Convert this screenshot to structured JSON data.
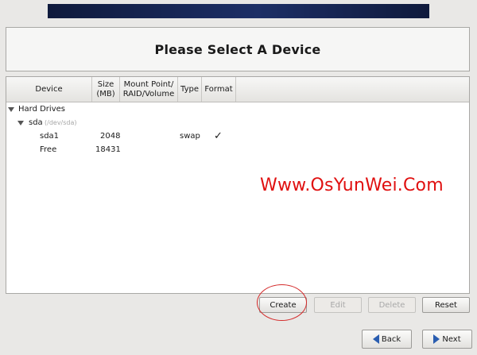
{
  "title": "Please Select A Device",
  "columns": [
    {
      "label": "Device"
    },
    {
      "label": "Size\n(MB)"
    },
    {
      "label": "Mount Point/\nRAID/Volume"
    },
    {
      "label": "Type"
    },
    {
      "label": "Format"
    }
  ],
  "tree": {
    "group_label": "Hard Drives",
    "disk_name": "sda",
    "disk_path": "(/dev/sda)",
    "partitions": [
      {
        "device": "sda1",
        "size": "2048",
        "type": "swap",
        "format": "✓"
      },
      {
        "device": "Free",
        "size": "18431",
        "type": "",
        "format": ""
      }
    ]
  },
  "actions": {
    "create": "Create",
    "edit": "Edit",
    "delete": "Delete",
    "reset": "Reset"
  },
  "nav": {
    "back": "Back",
    "next": "Next"
  },
  "watermark": "Www.OsYunWei.Com",
  "colors": {
    "banner": "#1d2f66",
    "watermark": "#e01010",
    "highlight_ring": "#d42a2a",
    "nav_arrow": "#2a5db0"
  },
  "icons": {
    "expand": "triangle-down-icon",
    "format_check": "check-icon",
    "back": "arrow-left-icon",
    "next": "arrow-right-icon"
  }
}
